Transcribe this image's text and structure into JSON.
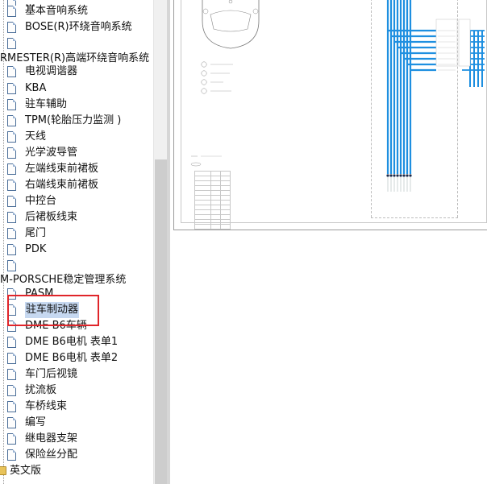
{
  "tree": {
    "top_partial_label": "…",
    "items": [
      {
        "label": "基本音响系统",
        "type": "doc"
      },
      {
        "label": "BOSE(R)环绕音响系统",
        "type": "doc"
      },
      {
        "label": "",
        "type": "doc"
      },
      {
        "label": "RMESTER(R)高端环绕音响系统",
        "type": "group"
      },
      {
        "label": "电视调谐器",
        "type": "doc"
      },
      {
        "label": "KBA",
        "type": "doc"
      },
      {
        "label": "驻车辅助",
        "type": "doc"
      },
      {
        "label": "TPM(轮胎压力监测 )",
        "type": "doc"
      },
      {
        "label": "天线",
        "type": "doc"
      },
      {
        "label": "光学波导管",
        "type": "doc"
      },
      {
        "label": "左端线束前裙板",
        "type": "doc"
      },
      {
        "label": "右端线束前裙板",
        "type": "doc"
      },
      {
        "label": "中控台",
        "type": "doc"
      },
      {
        "label": "后裙板线束",
        "type": "doc"
      },
      {
        "label": "尾门",
        "type": "doc"
      },
      {
        "label": "PDK",
        "type": "doc"
      },
      {
        "label": "",
        "type": "doc"
      },
      {
        "label": "M-PORSCHE稳定管理系统",
        "type": "group"
      },
      {
        "label": "PASM",
        "type": "doc"
      },
      {
        "label": "驻车制动器",
        "type": "doc",
        "selected": true
      },
      {
        "label": "DME B6车辆",
        "type": "doc"
      },
      {
        "label": "DME B6电机 表单1",
        "type": "doc"
      },
      {
        "label": "DME B6电机 表单2",
        "type": "doc"
      },
      {
        "label": "车门后视镜",
        "type": "doc"
      },
      {
        "label": "扰流板",
        "type": "doc"
      },
      {
        "label": "车桥线束",
        "type": "doc"
      },
      {
        "label": "编写",
        "type": "doc"
      },
      {
        "label": "继电器支架",
        "type": "doc"
      },
      {
        "label": "保险丝分配",
        "type": "doc"
      },
      {
        "label": "英文版",
        "type": "folder"
      }
    ]
  },
  "highlight_color": "#e0252a",
  "wire_color": "#1e8fe0"
}
